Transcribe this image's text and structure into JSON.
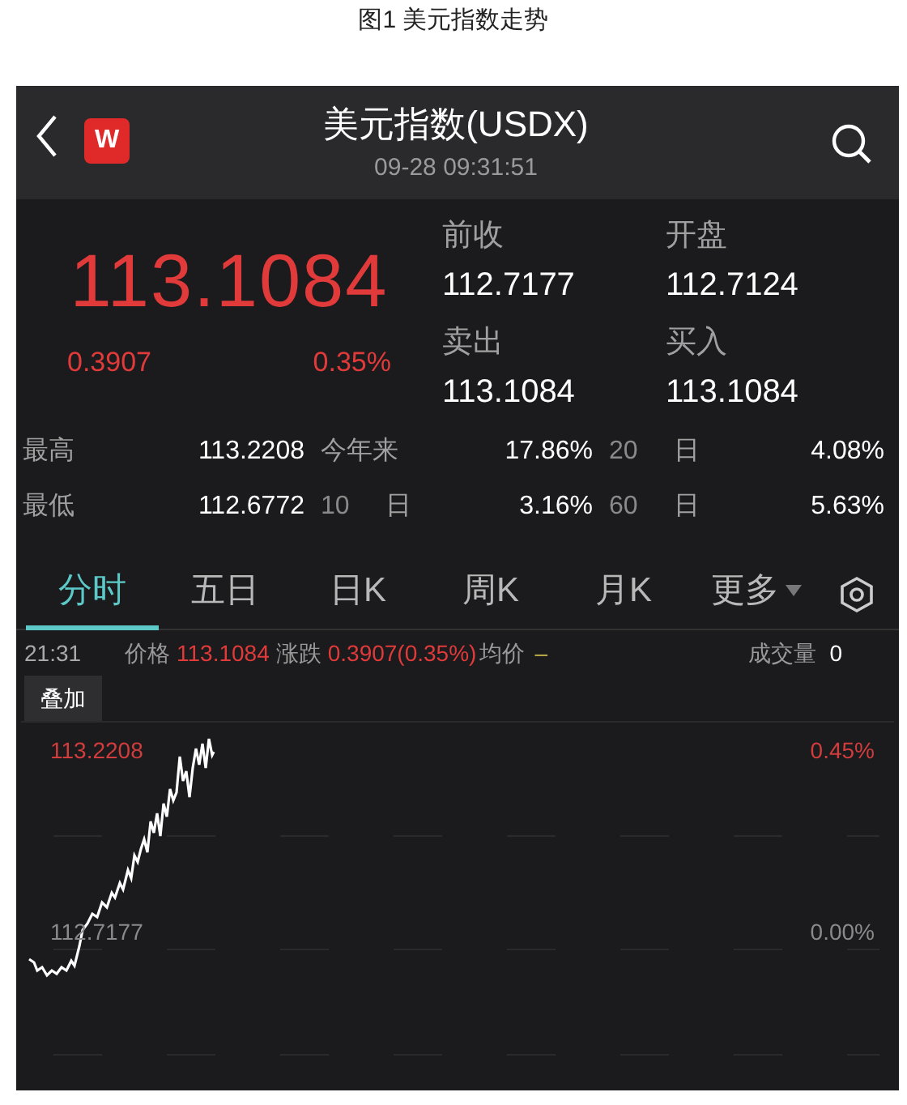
{
  "caption": "图1 美元指数走势",
  "header": {
    "logo": "W",
    "title": "美元指数(USDX)",
    "time": "09-28 09:31:51"
  },
  "quote": {
    "price": "113.1084",
    "change": "0.3907",
    "change_pct": "0.35%"
  },
  "fields": [
    {
      "label": "前收",
      "value": "112.7177"
    },
    {
      "label": "开盘",
      "value": "112.7124"
    },
    {
      "label": "卖出",
      "value": "113.1084"
    },
    {
      "label": "买入",
      "value": "113.1084"
    }
  ],
  "stats": [
    [
      {
        "label": "最高",
        "value": "113.2208"
      },
      {
        "label": "今年来",
        "value": "17.86%"
      },
      {
        "label": "20",
        "unit": "日",
        "value": "4.08%"
      }
    ],
    [
      {
        "label": "最低",
        "value": "112.6772"
      },
      {
        "label": "10",
        "unit": "日",
        "value": "3.16%"
      },
      {
        "label": "60",
        "unit": "日",
        "value": "5.63%"
      }
    ]
  ],
  "tabs": [
    {
      "label": "分时",
      "selected": true,
      "dropdown": false
    },
    {
      "label": "五日",
      "selected": false,
      "dropdown": false
    },
    {
      "label": "日K",
      "selected": false,
      "dropdown": false
    },
    {
      "label": "周K",
      "selected": false,
      "dropdown": false
    },
    {
      "label": "月K",
      "selected": false,
      "dropdown": false
    },
    {
      "label": "更多",
      "selected": false,
      "dropdown": true
    }
  ],
  "info": {
    "time": "21:31",
    "price_label": "价格",
    "price": "113.1084",
    "change_label": "涨跌",
    "change": "0.3907(0.35%)",
    "avg_label": "均价",
    "avg": "–",
    "volume_label": "成交量",
    "volume": "0"
  },
  "overlay_button": "叠加",
  "chart": {
    "high": "113.2208",
    "high_pct": "0.45%",
    "base": "112.7177",
    "base_pct": "0.00%"
  }
}
